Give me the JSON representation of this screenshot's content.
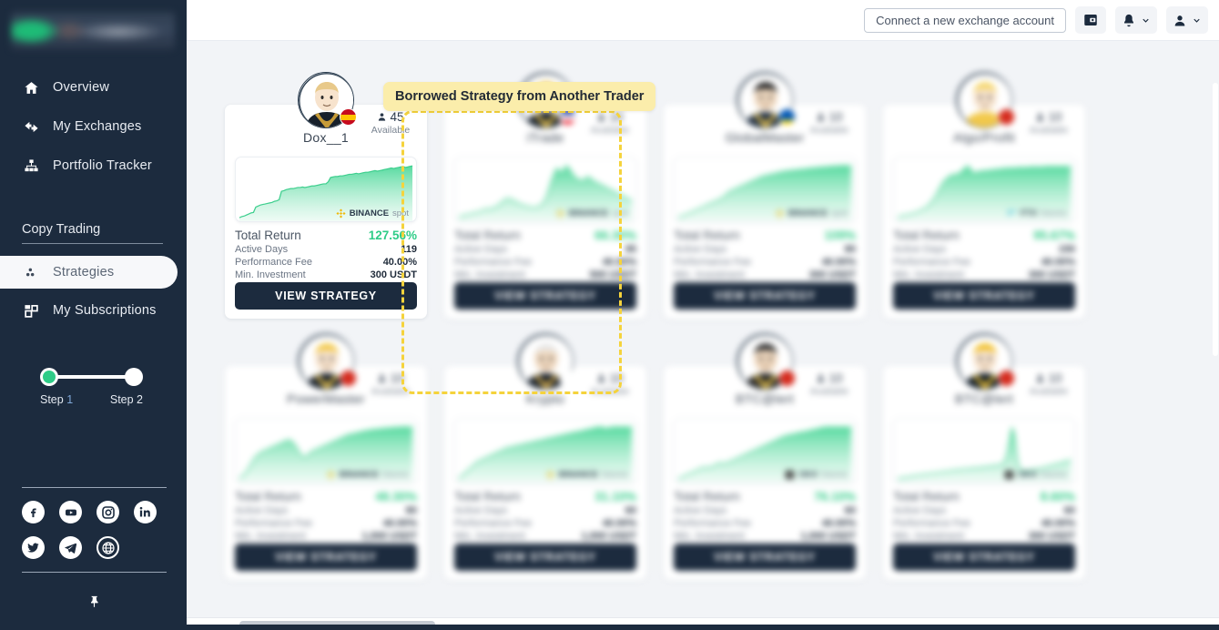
{
  "sidebar": {
    "logo_alt": "company-logo",
    "nav": [
      {
        "label": "Overview",
        "icon": "home-icon"
      },
      {
        "label": "My Exchanges",
        "icon": "exchange-arrows-icon"
      },
      {
        "label": "Portfolio Tracker",
        "icon": "sitemap-icon"
      }
    ],
    "section_title": "Copy Trading",
    "copy_nav": [
      {
        "label": "Strategies",
        "icon": "dots-cluster-icon",
        "active": true
      },
      {
        "label": "My Subscriptions",
        "icon": "layers-icon",
        "active": false
      }
    ],
    "stepper": {
      "step1": "Step 1",
      "step1_num": "1",
      "step2": "Step 2",
      "active_color": "#2ecc87"
    },
    "social": [
      {
        "name": "facebook-icon"
      },
      {
        "name": "youtube-icon"
      },
      {
        "name": "instagram-icon"
      },
      {
        "name": "linkedin-icon"
      },
      {
        "name": "twitter-icon"
      },
      {
        "name": "telegram-icon"
      },
      {
        "name": "globe-icon"
      }
    ],
    "pin": "pin-icon"
  },
  "topbar": {
    "connect_label": "Connect a new exchange account",
    "wallet_icon": "wallet-icon",
    "bell_icon": "bell-icon",
    "user_icon": "user-icon",
    "chevron_icon": "chevron-down-icon"
  },
  "tooltip": {
    "text": "Borrowed Strategy from Another Trader",
    "bg": "#fbedab"
  },
  "labels": {
    "available": "Available",
    "total_return": "Total Return",
    "active_days": "Active Days",
    "performance_fee": "Performance Fee",
    "min_investment": "Min. Investment",
    "view_strategy": "VIEW STRATEGY"
  },
  "colors": {
    "accent_green": "#2ecc87",
    "dark_navy": "#1c2b3e",
    "highlight_yellow": "#f5d33c"
  },
  "cards": [
    {
      "id": "dox-1",
      "trader": "Dox__1",
      "available": "45",
      "exchange": "BINANCE",
      "market": "spot",
      "total_return": "127.56%",
      "active_days": "119",
      "performance_fee": "40.00%",
      "min_investment": "300 USDT",
      "highlighted": true,
      "blurred": false,
      "chart": [
        2,
        4,
        5,
        7,
        9,
        11,
        12,
        22,
        24,
        26,
        27,
        28,
        29,
        30,
        31,
        33,
        34,
        36,
        52,
        53,
        55,
        56,
        57,
        57,
        58,
        59,
        59,
        60,
        59,
        60,
        61,
        62,
        62,
        63,
        64,
        65,
        66,
        66,
        70,
        78,
        79,
        80,
        80,
        81,
        81,
        82,
        83,
        84,
        84,
        85,
        86,
        85,
        86,
        87,
        88,
        88,
        89,
        90,
        91,
        90,
        91,
        92,
        93,
        94,
        95,
        96,
        95,
        96,
        97,
        98,
        99,
        97,
        98,
        99,
        100
      ]
    },
    {
      "id": "card-2",
      "trader": "iTrade",
      "available": "10",
      "exchange": "BINANCE",
      "market": "spot",
      "total_return": "66.30%",
      "active_days": "95",
      "performance_fee": "40.00%",
      "min_investment": "500 USDT",
      "highlighted": false,
      "blurred": true,
      "chart": [
        10,
        12,
        14,
        13,
        15,
        16,
        18,
        17,
        19,
        20,
        22,
        24,
        23,
        25,
        24,
        26,
        28,
        30,
        34,
        38,
        40,
        42,
        41,
        39,
        37,
        35,
        33,
        31,
        30,
        29,
        28,
        27,
        26,
        27,
        28,
        30,
        34,
        40,
        50,
        62,
        74,
        84,
        92,
        88,
        82,
        90,
        96,
        92,
        86,
        80,
        76,
        74,
        72,
        70,
        74,
        78,
        76,
        72,
        70,
        68,
        66,
        64,
        62,
        60,
        58,
        56,
        54,
        52,
        50,
        48,
        46,
        44,
        42,
        40,
        38
      ]
    },
    {
      "id": "card-3",
      "trader": "GlobalMaster",
      "available": "10",
      "exchange": "BINANCE",
      "market": "spot",
      "total_return": "109%",
      "active_days": "80",
      "performance_fee": "40.00%",
      "min_investment": "300 USDT",
      "highlighted": false,
      "blurred": true,
      "chart": [
        3,
        5,
        7,
        8,
        10,
        12,
        14,
        16,
        18,
        20,
        22,
        24,
        26,
        28,
        30,
        32,
        34,
        36,
        38,
        40,
        44,
        48,
        52,
        54,
        56,
        58,
        60,
        62,
        64,
        66,
        68,
        70,
        72,
        74,
        76,
        78,
        80,
        81,
        82,
        83,
        84,
        85,
        86,
        87,
        88,
        89,
        90,
        90,
        91,
        91,
        92,
        92,
        93,
        93,
        94,
        94,
        95,
        95,
        96,
        96,
        97,
        97,
        97,
        98,
        98,
        98,
        99,
        99,
        99,
        100,
        100,
        100,
        100,
        100,
        100
      ]
    },
    {
      "id": "card-4",
      "trader": "Algo/Profit",
      "available": "10",
      "exchange": "FTX",
      "market": "futures",
      "total_return": "95.67%",
      "active_days": "150",
      "performance_fee": "40.00%",
      "min_investment": "300 USDT",
      "highlighted": false,
      "blurred": true,
      "chart": [
        4,
        6,
        8,
        7,
        9,
        11,
        10,
        12,
        14,
        16,
        18,
        20,
        22,
        26,
        30,
        36,
        42,
        50,
        58,
        66,
        72,
        76,
        80,
        82,
        84,
        83,
        85,
        88,
        92,
        96,
        100,
        94,
        88,
        86,
        88,
        90,
        89,
        91,
        90,
        92,
        91,
        93,
        92,
        94,
        93,
        95,
        94,
        96,
        95,
        96,
        95,
        96,
        97,
        96,
        97,
        96,
        97,
        98,
        97,
        98,
        97,
        98,
        97,
        98,
        99,
        98,
        99,
        98,
        99,
        98,
        99,
        98,
        99,
        98,
        99
      ]
    },
    {
      "id": "card-5",
      "trader": "PowerMaster",
      "available": "10",
      "exchange": "BINANCE",
      "market": "futures",
      "total_return": "48.30%",
      "active_days": "80",
      "performance_fee": "40.00%",
      "min_investment": "1,000 USDT",
      "highlighted": false,
      "blurred": true,
      "chart": [
        2,
        6,
        10,
        16,
        22,
        30,
        38,
        44,
        48,
        52,
        54,
        56,
        58,
        60,
        62,
        64,
        66,
        68,
        70,
        72,
        74,
        76,
        74,
        70,
        64,
        56,
        50,
        44,
        42,
        46,
        50,
        54,
        56,
        58,
        60,
        62,
        64,
        66,
        68,
        70,
        72,
        74,
        76,
        78,
        80,
        82,
        84,
        86,
        86,
        88,
        88,
        90,
        90,
        92,
        92,
        94,
        94,
        95,
        95,
        96,
        96,
        97,
        97,
        98,
        98,
        98,
        99,
        99,
        99,
        100,
        100,
        100,
        100,
        100,
        100
      ]
    },
    {
      "id": "card-6",
      "trader": "Krypto",
      "available": "10",
      "exchange": "BINANCE",
      "market": "futures",
      "total_return": "31.10%",
      "active_days": "60",
      "performance_fee": "40.00%",
      "min_investment": "1,000 USDT",
      "highlighted": false,
      "blurred": true,
      "chart": [
        4,
        8,
        12,
        16,
        20,
        24,
        28,
        32,
        36,
        38,
        40,
        42,
        44,
        46,
        48,
        50,
        52,
        54,
        56,
        58,
        60,
        62,
        62,
        64,
        64,
        66,
        66,
        68,
        68,
        70,
        70,
        72,
        72,
        74,
        74,
        76,
        76,
        78,
        78,
        80,
        80,
        82,
        82,
        84,
        84,
        86,
        86,
        88,
        88,
        90,
        90,
        91,
        92,
        93,
        94,
        95,
        96,
        97,
        98,
        99,
        100,
        100,
        98,
        97,
        98,
        99,
        100,
        100,
        100,
        100,
        100,
        100,
        100,
        100,
        100
      ]
    },
    {
      "id": "card-7",
      "trader": "BTC@lert",
      "available": "10",
      "exchange": "OKX",
      "market": "futures",
      "total_return": "76.10%",
      "active_days": "60",
      "performance_fee": "40.00%",
      "min_investment": "1,000 USDT",
      "highlighted": false,
      "blurred": true,
      "chart": [
        4,
        6,
        8,
        10,
        12,
        14,
        16,
        18,
        20,
        22,
        24,
        26,
        25,
        24,
        26,
        28,
        30,
        32,
        34,
        33,
        32,
        34,
        36,
        38,
        40,
        42,
        44,
        46,
        48,
        50,
        52,
        54,
        56,
        58,
        60,
        62,
        64,
        66,
        68,
        70,
        72,
        74,
        76,
        78,
        80,
        82,
        84,
        84,
        86,
        86,
        88,
        88,
        90,
        90,
        91,
        92,
        93,
        94,
        95,
        96,
        97,
        98,
        99,
        100,
        100,
        100,
        100,
        100,
        100,
        100,
        100,
        100,
        100,
        100,
        100
      ]
    },
    {
      "id": "card-8",
      "trader": "BTC@lert",
      "available": "10",
      "exchange": "OKX",
      "market": "futures",
      "total_return": "8.60%",
      "active_days": "60",
      "performance_fee": "40.00%",
      "min_investment": "300 USDT",
      "highlighted": false,
      "blurred": true,
      "chart": [
        20,
        21,
        22,
        22,
        23,
        23,
        24,
        25,
        25,
        26,
        26,
        27,
        27,
        28,
        28,
        29,
        29,
        30,
        30,
        31,
        31,
        32,
        32,
        33,
        33,
        34,
        34,
        35,
        35,
        35,
        36,
        36,
        36,
        37,
        37,
        37,
        38,
        38,
        39,
        39,
        40,
        40,
        41,
        41,
        42,
        44,
        48,
        60,
        80,
        100,
        86,
        52,
        36,
        34,
        33,
        33,
        34,
        34,
        35,
        35,
        36,
        36,
        37,
        38,
        39,
        40,
        41,
        42,
        43,
        44,
        45,
        46,
        47,
        48,
        50
      ]
    }
  ]
}
